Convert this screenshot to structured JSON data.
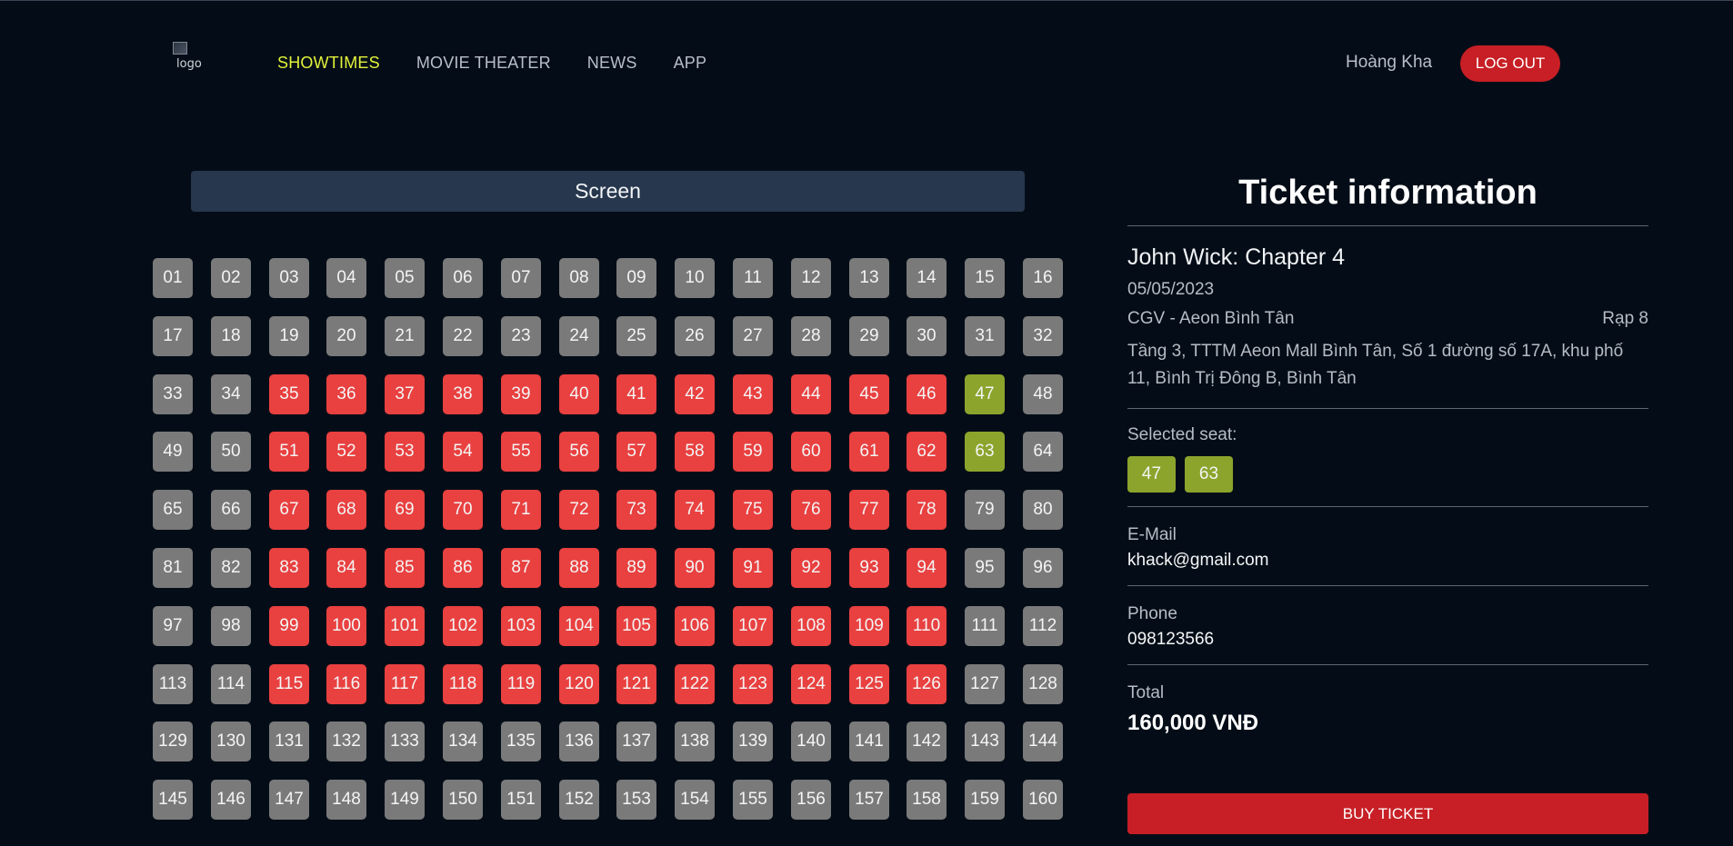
{
  "header": {
    "logo_alt": "logo",
    "nav": [
      {
        "label": "SHOWTIMES",
        "active": true
      },
      {
        "label": "MOVIE THEATER",
        "active": false
      },
      {
        "label": "NEWS",
        "active": false
      },
      {
        "label": "APP",
        "active": false
      }
    ],
    "user_name": "Hoàng Kha",
    "logout_label": "LOG OUT"
  },
  "screen_label": "Screen",
  "seats": {
    "columns": 16,
    "total": 160,
    "booked": [
      35,
      36,
      37,
      38,
      39,
      40,
      41,
      42,
      43,
      44,
      45,
      46,
      51,
      52,
      53,
      54,
      55,
      56,
      57,
      58,
      59,
      60,
      61,
      62,
      67,
      68,
      69,
      70,
      71,
      72,
      73,
      74,
      75,
      76,
      77,
      78,
      83,
      84,
      85,
      86,
      87,
      88,
      89,
      90,
      91,
      92,
      93,
      94,
      99,
      100,
      101,
      102,
      103,
      104,
      105,
      106,
      107,
      108,
      109,
      110,
      115,
      116,
      117,
      118,
      119,
      120,
      121,
      122,
      123,
      124,
      125,
      126
    ],
    "selected": [
      47,
      63
    ]
  },
  "ticket": {
    "title": "Ticket information",
    "movie": "John Wick: Chapter 4",
    "date": "05/05/2023",
    "cinema": "CGV - Aeon Bình Tân",
    "room": "Rạp 8",
    "address": "Tầng 3, TTTM Aeon Mall Bình Tân, Số 1 đường số 17A, khu phố 11, Bình Trị Đông B, Bình Tân",
    "selected_seat_label": "Selected seat:",
    "selected_seats": [
      "47",
      "63"
    ],
    "email_label": "E-Mail",
    "email": "khack@gmail.com",
    "phone_label": "Phone",
    "phone": "098123566",
    "total_label": "Total",
    "total": "160,000 VNĐ",
    "buy_label": "BUY TICKET"
  },
  "colors": {
    "background": "#040d17",
    "accent_nav": "#e2f23a",
    "seat_available": "#7a7a7a",
    "seat_booked": "#e94040",
    "seat_selected": "#8ca42c",
    "button_red": "#c71f25"
  }
}
